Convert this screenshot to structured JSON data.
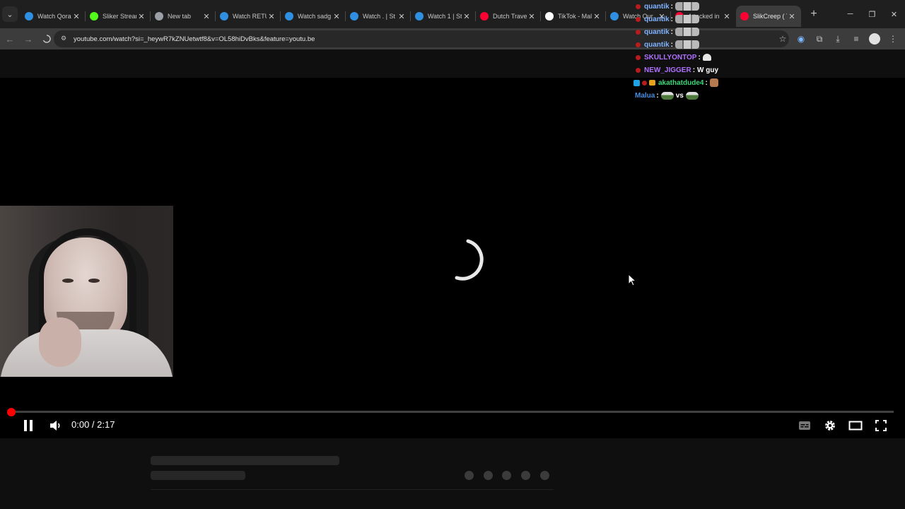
{
  "browser": {
    "tabs": [
      {
        "title": "Watch Qorai",
        "favicon": "stream-icon",
        "color": "#2f8fe0"
      },
      {
        "title": "Sliker Stream",
        "favicon": "kick-icon",
        "color": "#53fc18"
      },
      {
        "title": "New tab",
        "favicon": "chrome-icon",
        "color": "#9aa0a6"
      },
      {
        "title": "Watch RETU",
        "favicon": "stream-icon",
        "color": "#2f8fe0"
      },
      {
        "title": "Watch sadg",
        "favicon": "stream-icon",
        "color": "#2f8fe0"
      },
      {
        "title": "Watch . | St",
        "favicon": "stream-icon",
        "color": "#2f8fe0"
      },
      {
        "title": "Watch 1 | St",
        "favicon": "stream-icon",
        "color": "#2f8fe0"
      },
      {
        "title": "Dutch Travel",
        "favicon": "youtube-icon",
        "color": "#ff0033"
      },
      {
        "title": "TikTok - Mal",
        "favicon": "tiktok-icon",
        "color": "#ffffff"
      },
      {
        "title": "Watch Our",
        "favicon": "stream-icon",
        "color": "#2f8fe0"
      },
      {
        "title": "Attacked in",
        "favicon": "youtube-icon",
        "color": "#ff0033"
      },
      {
        "title": "SlikCreep ( T",
        "favicon": "youtube-icon",
        "color": "#ff0033"
      }
    ],
    "active_tab_index": 11,
    "url": "youtube.com/watch?si=_heywR7kZNUetwtf8&v=OL58hiDvBks&feature=youtu.be"
  },
  "chat": [
    {
      "user": "quantik",
      "color": "#7fb2ff",
      "message": "",
      "emote": "grey"
    },
    {
      "user": "quantik",
      "color": "#7fb2ff",
      "message": "",
      "emote": "grey"
    },
    {
      "user": "quantik",
      "color": "#7fb2ff",
      "message": "",
      "emote": "grey"
    },
    {
      "user": "quantik",
      "color": "#7fb2ff",
      "message": "",
      "emote": "grey"
    },
    {
      "user": "SKULLYONTOP",
      "color": "#b070ff",
      "message": "",
      "emote": "ghost"
    },
    {
      "user": "NEW_JIGGER",
      "color": "#b070ff",
      "message": "W guy",
      "emote": ""
    },
    {
      "user": "akathatdude4",
      "color": "#3ad87a",
      "message": "",
      "emote": "cat"
    },
    {
      "user": "Malua",
      "color": "#4a8de0",
      "message": "vs",
      "emote": "frog"
    }
  ],
  "player": {
    "current_time": "0:00",
    "duration": "2:17",
    "time_display": "0:00 / 2:17",
    "progress": 0.0,
    "state": "loading"
  },
  "colors": {
    "youtube_red": "#ff0000",
    "background": "#0f0f0f"
  }
}
